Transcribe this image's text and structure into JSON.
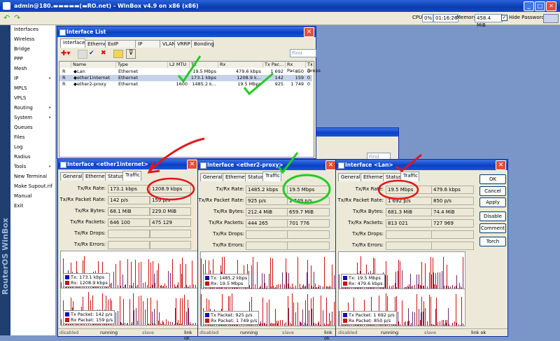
{
  "window": {
    "title": "admin@180.▬▬▬▬▬(▬RO.net) - WinBox v4.9 on x86 (x86)"
  },
  "toolbar": {
    "cpu_label": "CPU:",
    "cpu_value": "0%",
    "uptime": "01:16:26",
    "memory_label": "Memory:",
    "memory_value": "458.4 MiB",
    "hide_passwords": "Hide Passwords"
  },
  "brand": "RouterOS WinBox",
  "menu": [
    {
      "label": "Interfaces",
      "arrow": false
    },
    {
      "label": "Wireless",
      "arrow": false
    },
    {
      "label": "Bridge",
      "arrow": false
    },
    {
      "label": "PPP",
      "arrow": false
    },
    {
      "label": "Mesh",
      "arrow": false
    },
    {
      "label": "IP",
      "arrow": true
    },
    {
      "label": "MPLS",
      "arrow": false
    },
    {
      "label": "VPLS",
      "arrow": false
    },
    {
      "label": "Routing",
      "arrow": true
    },
    {
      "label": "System",
      "arrow": true
    },
    {
      "label": "Queues",
      "arrow": false
    },
    {
      "label": "Files",
      "arrow": false
    },
    {
      "label": "Log",
      "arrow": false
    },
    {
      "label": "Radius",
      "arrow": false
    },
    {
      "label": "Tools",
      "arrow": true
    },
    {
      "label": "New Terminal",
      "arrow": false
    },
    {
      "label": "Make Supout.rif",
      "arrow": false
    },
    {
      "label": "Manual",
      "arrow": false
    },
    {
      "label": "Exit",
      "arrow": false
    }
  ],
  "interface_list": {
    "title": "Interface List",
    "tabs": [
      "Interface",
      "Ethernet",
      "EoIP Tunnel",
      "IP Tunnel",
      "VLAN",
      "VRRP",
      "Bonding"
    ],
    "find_placeholder": "Find",
    "columns": [
      "Name",
      "Type",
      "L2 MTU",
      "Tx",
      "Rx",
      "Tx Pac...",
      "Rx Pac...",
      "Tx Drops"
    ],
    "rows": [
      {
        "flag": "R",
        "name": "◆Lan",
        "type": "Ethernet",
        "mtu": "",
        "tx": "19.5 Mbps",
        "rx": "479.6 kbps",
        "txp": "1 692",
        "rxp": "850",
        "drops": "0"
      },
      {
        "flag": "R",
        "name": "◆ether1internet",
        "type": "Ethernet",
        "mtu": "",
        "tx": "173.1 kbps",
        "rx": "1208.9 k...",
        "txp": "142",
        "rxp": "159",
        "drops": "0"
      },
      {
        "flag": "R",
        "name": "◆ether2-proxy",
        "type": "Ethernet",
        "mtu": "1600",
        "tx": "1485.2 k...",
        "rx": "19.5 Mbps",
        "txp": "925",
        "rxp": "1 749",
        "drops": "0"
      }
    ]
  },
  "bg_window": {
    "find_placeholder": "Find"
  },
  "iface_windows": [
    {
      "title": "Interface <ether1internet>",
      "tabs": [
        "General",
        "Ethernet",
        "Status",
        "Traffic"
      ],
      "rows": [
        {
          "label": "Tx/Rx Rate:",
          "a": "173.1 kbps",
          "b": "1208.9 kbps"
        },
        {
          "label": "Tx/Rx Packet Rate:",
          "a": "142 p/s",
          "b": "159 p/s"
        },
        {
          "label": "Tx/Rx Bytes:",
          "a": "68.1 MiB",
          "b": "229.0 MiB"
        },
        {
          "label": "Tx/Rx Packets:",
          "a": "646 100",
          "b": "475 129"
        },
        {
          "label": "Tx/Rx Drops:",
          "a": "",
          "b": ""
        },
        {
          "label": "Tx/Rx Errors:",
          "a": "",
          "b": ""
        }
      ],
      "legend1": [
        "Tx:  173.1 kbps",
        "Rx:  1208.9 kbps"
      ],
      "legend2": [
        "Tx Packet:  142 p/s",
        "Rx Packet:  159 p/s"
      ],
      "status": [
        "disabled",
        "running",
        "slave",
        "link ok"
      ]
    },
    {
      "title": "Interface <ether2-proxy>",
      "tabs": [
        "General",
        "Ethernet",
        "Status",
        "Traffic"
      ],
      "rows": [
        {
          "label": "Tx/Rx Rate:",
          "a": "1485.2 kbps",
          "b": "19.5 Mbps"
        },
        {
          "label": "Tx/Rx Packet Rate:",
          "a": "925 p/s",
          "b": "1 749 p/s"
        },
        {
          "label": "Tx/Rx Bytes:",
          "a": "212.4 MiB",
          "b": "659.7 MiB"
        },
        {
          "label": "Tx/Rx Packets:",
          "a": "444 265",
          "b": "701 776"
        },
        {
          "label": "Tx/Rx Drops:",
          "a": "",
          "b": ""
        },
        {
          "label": "Tx/Rx Errors:",
          "a": "",
          "b": ""
        }
      ],
      "legend1": [
        "Tx:  1485.2 kbps",
        "Rx:  19.5 Mbps"
      ],
      "legend2": [
        "Tx Packet:  925 p/s",
        "Rx Packet:  1 749 p/s"
      ],
      "status": [
        "disabled",
        "running",
        "slave",
        "link ok"
      ]
    },
    {
      "title": "Interface <Lan>",
      "tabs": [
        "General",
        "Ethernet",
        "Status",
        "Traffic"
      ],
      "rows": [
        {
          "label": "Tx/Rx Rate:",
          "a": "19.5 Mbps",
          "b": "479.6 kbps"
        },
        {
          "label": "Tx/Rx Packet Rate:",
          "a": "1 692 p/s",
          "b": "850 p/s"
        },
        {
          "label": "Tx/Rx Bytes:",
          "a": "681.3 MiB",
          "b": "74.4 MiB"
        },
        {
          "label": "Tx/Rx Packets:",
          "a": "813 021",
          "b": "727 969"
        },
        {
          "label": "Tx/Rx Drops:",
          "a": "",
          "b": ""
        },
        {
          "label": "Tx/Rx Errors:",
          "a": "",
          "b": ""
        }
      ],
      "legend1": [
        "Tx:  19.5 Mbps",
        "Rx:  479.6 kbps"
      ],
      "legend2": [
        "Tx Packet:  1 692 p/s",
        "Rx Packet:  850 p/s"
      ],
      "status": [
        "disabled",
        "running",
        "slave",
        "link ok"
      ],
      "buttons": [
        "OK",
        "Cancel",
        "Apply",
        "Disable",
        "Comment",
        "Torch"
      ]
    }
  ],
  "colors": {
    "tx": "#1010c0",
    "rx": "#d01010",
    "annotation_red": "#e01818",
    "annotation_green": "#22cc22"
  }
}
